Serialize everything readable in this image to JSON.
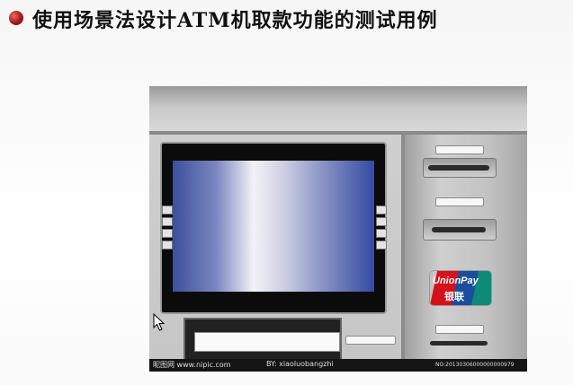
{
  "slide": {
    "title": "使用场景法设计ATM机取款功能的测试用例"
  },
  "image": {
    "unionpay_text": "UnionPay",
    "unionpay_cn": "银联",
    "watermark_site": "昵图网 www.nipic.com",
    "watermark_author": "BY: xiaoluobangzhi",
    "watermark_id": "NO:20130306000000000979"
  },
  "icons": {
    "bullet": "red-sphere-bullet",
    "cursor": "mouse-pointer-arrow"
  },
  "colors": {
    "bullet": "#a01818",
    "screen_blue": "#3b4f9b",
    "atm_gray": "#c4c4c4"
  }
}
